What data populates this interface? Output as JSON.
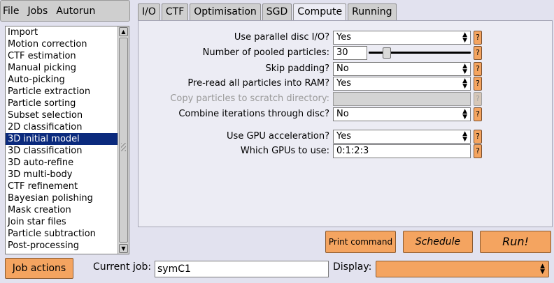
{
  "menu": {
    "items": [
      "File",
      "Jobs",
      "Autorun"
    ]
  },
  "joblist": {
    "items": [
      "Import",
      "Motion correction",
      "CTF estimation",
      "Manual picking",
      "Auto-picking",
      "Particle extraction",
      "Particle sorting",
      "Subset selection",
      "2D classification",
      "3D initial model",
      "3D classification",
      "3D auto-refine",
      "3D multi-body",
      "CTF refinement",
      "Bayesian polishing",
      "Mask creation",
      "Join star files",
      "Particle subtraction",
      "Post-processing"
    ],
    "selected": "3D initial model"
  },
  "tabs": [
    "I/O",
    "CTF",
    "Optimisation",
    "SGD",
    "Compute",
    "Running"
  ],
  "active_tab": "Compute",
  "form": {
    "parallel_io": {
      "label": "Use parallel disc I/O?",
      "value": "Yes"
    },
    "pooled": {
      "label": "Number of pooled particles:",
      "value": "30",
      "slider_fraction": 0.15
    },
    "skip_padding": {
      "label": "Skip padding?",
      "value": "No"
    },
    "preread": {
      "label": "Pre-read all particles into RAM?",
      "value": "Yes"
    },
    "scratch": {
      "label": "Copy particles to scratch directory:",
      "value": ""
    },
    "combine": {
      "label": "Combine iterations through disc?",
      "value": "No"
    },
    "gpu": {
      "label": "Use GPU acceleration?",
      "value": "Yes"
    },
    "gpus": {
      "label": "Which GPUs to use:",
      "value": "0:1:2:3"
    },
    "help": "?"
  },
  "actions": {
    "print": "Print command",
    "schedule": "Schedule",
    "run": "Run!"
  },
  "bottom": {
    "job_actions": "Job actions",
    "current_job_label": "Current job:",
    "current_job_value": "symC1",
    "display_label": "Display:",
    "display_value": ""
  },
  "colors": {
    "accent_orange": "#f4a460",
    "selection_blue": "#0b2a7d",
    "panel_bg": "#ececf4"
  }
}
